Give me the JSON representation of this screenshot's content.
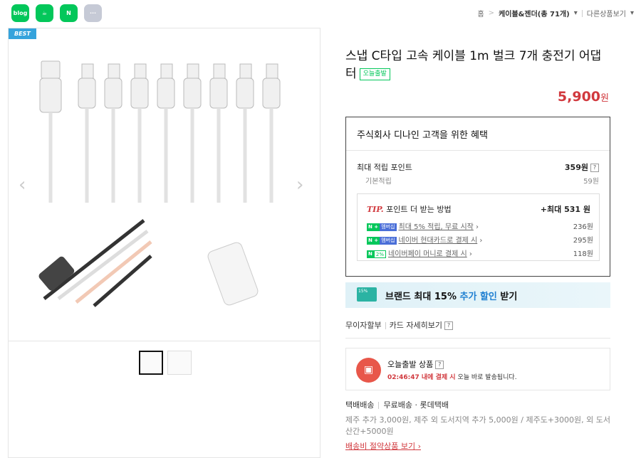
{
  "share": {
    "blog": "blog",
    "cafe": "☕",
    "keep": "N",
    "more": "···"
  },
  "breadcrumb": {
    "home": "홈",
    "category": "케이블&젠더(총 71개)",
    "other": "다른상품보기"
  },
  "gallery": {
    "badge": "BEST",
    "thumbnails": 2
  },
  "product": {
    "title": "스냅 C타입 고속 케이블 1m 벌크 7개 충전기 어댑터",
    "badge": "오늘출발",
    "price": "5,900",
    "price_unit": "원"
  },
  "benefit": {
    "title": "주식회사 디나인 고객을 위한 혜택",
    "max_points_label": "최대 적립 포인트",
    "max_points": "359원",
    "base_label": "기본적립",
    "base_points": "59원",
    "tip_label": "TIP.",
    "tip_text": "포인트 더 받는 방법",
    "tip_max": "+최대 531 원",
    "tips": [
      {
        "badge": "N +",
        "badge2": "멤버십",
        "text": "최대 5% 적립, 무료 시작",
        "value": "236원"
      },
      {
        "badge": "N +",
        "badge2": "멤버십",
        "text": "네이버 현대카드로 결제 시",
        "value": "295원"
      },
      {
        "badge": "N",
        "badge2": "2%",
        "text": "네이버페이 머니로 결제 시",
        "value": "118원"
      }
    ]
  },
  "banner": {
    "text": "브랜드 최대 15%",
    "highlight": "추가 할인",
    "suffix": "받기",
    "coupon": "15%"
  },
  "pay": {
    "installment": "무이자할부",
    "card": "카드 자세히보기"
  },
  "shipping": {
    "title": "오늘출발 상품",
    "deadline": "02:46:47 내에 결제 시",
    "desc": "오늘 바로 발송됩니다."
  },
  "delivery": {
    "type": "택배배송",
    "fee": "무료배송 · 롯데택배",
    "extra": "제주 추가 3,000원, 제주 외 도서지역 추가 5,000원 / 제주도+3000원, 외 도서산간+5000원",
    "link": "배송비 절약상품 보기"
  },
  "colors": {
    "accent": "#d1393e",
    "naver": "#03c75a"
  }
}
